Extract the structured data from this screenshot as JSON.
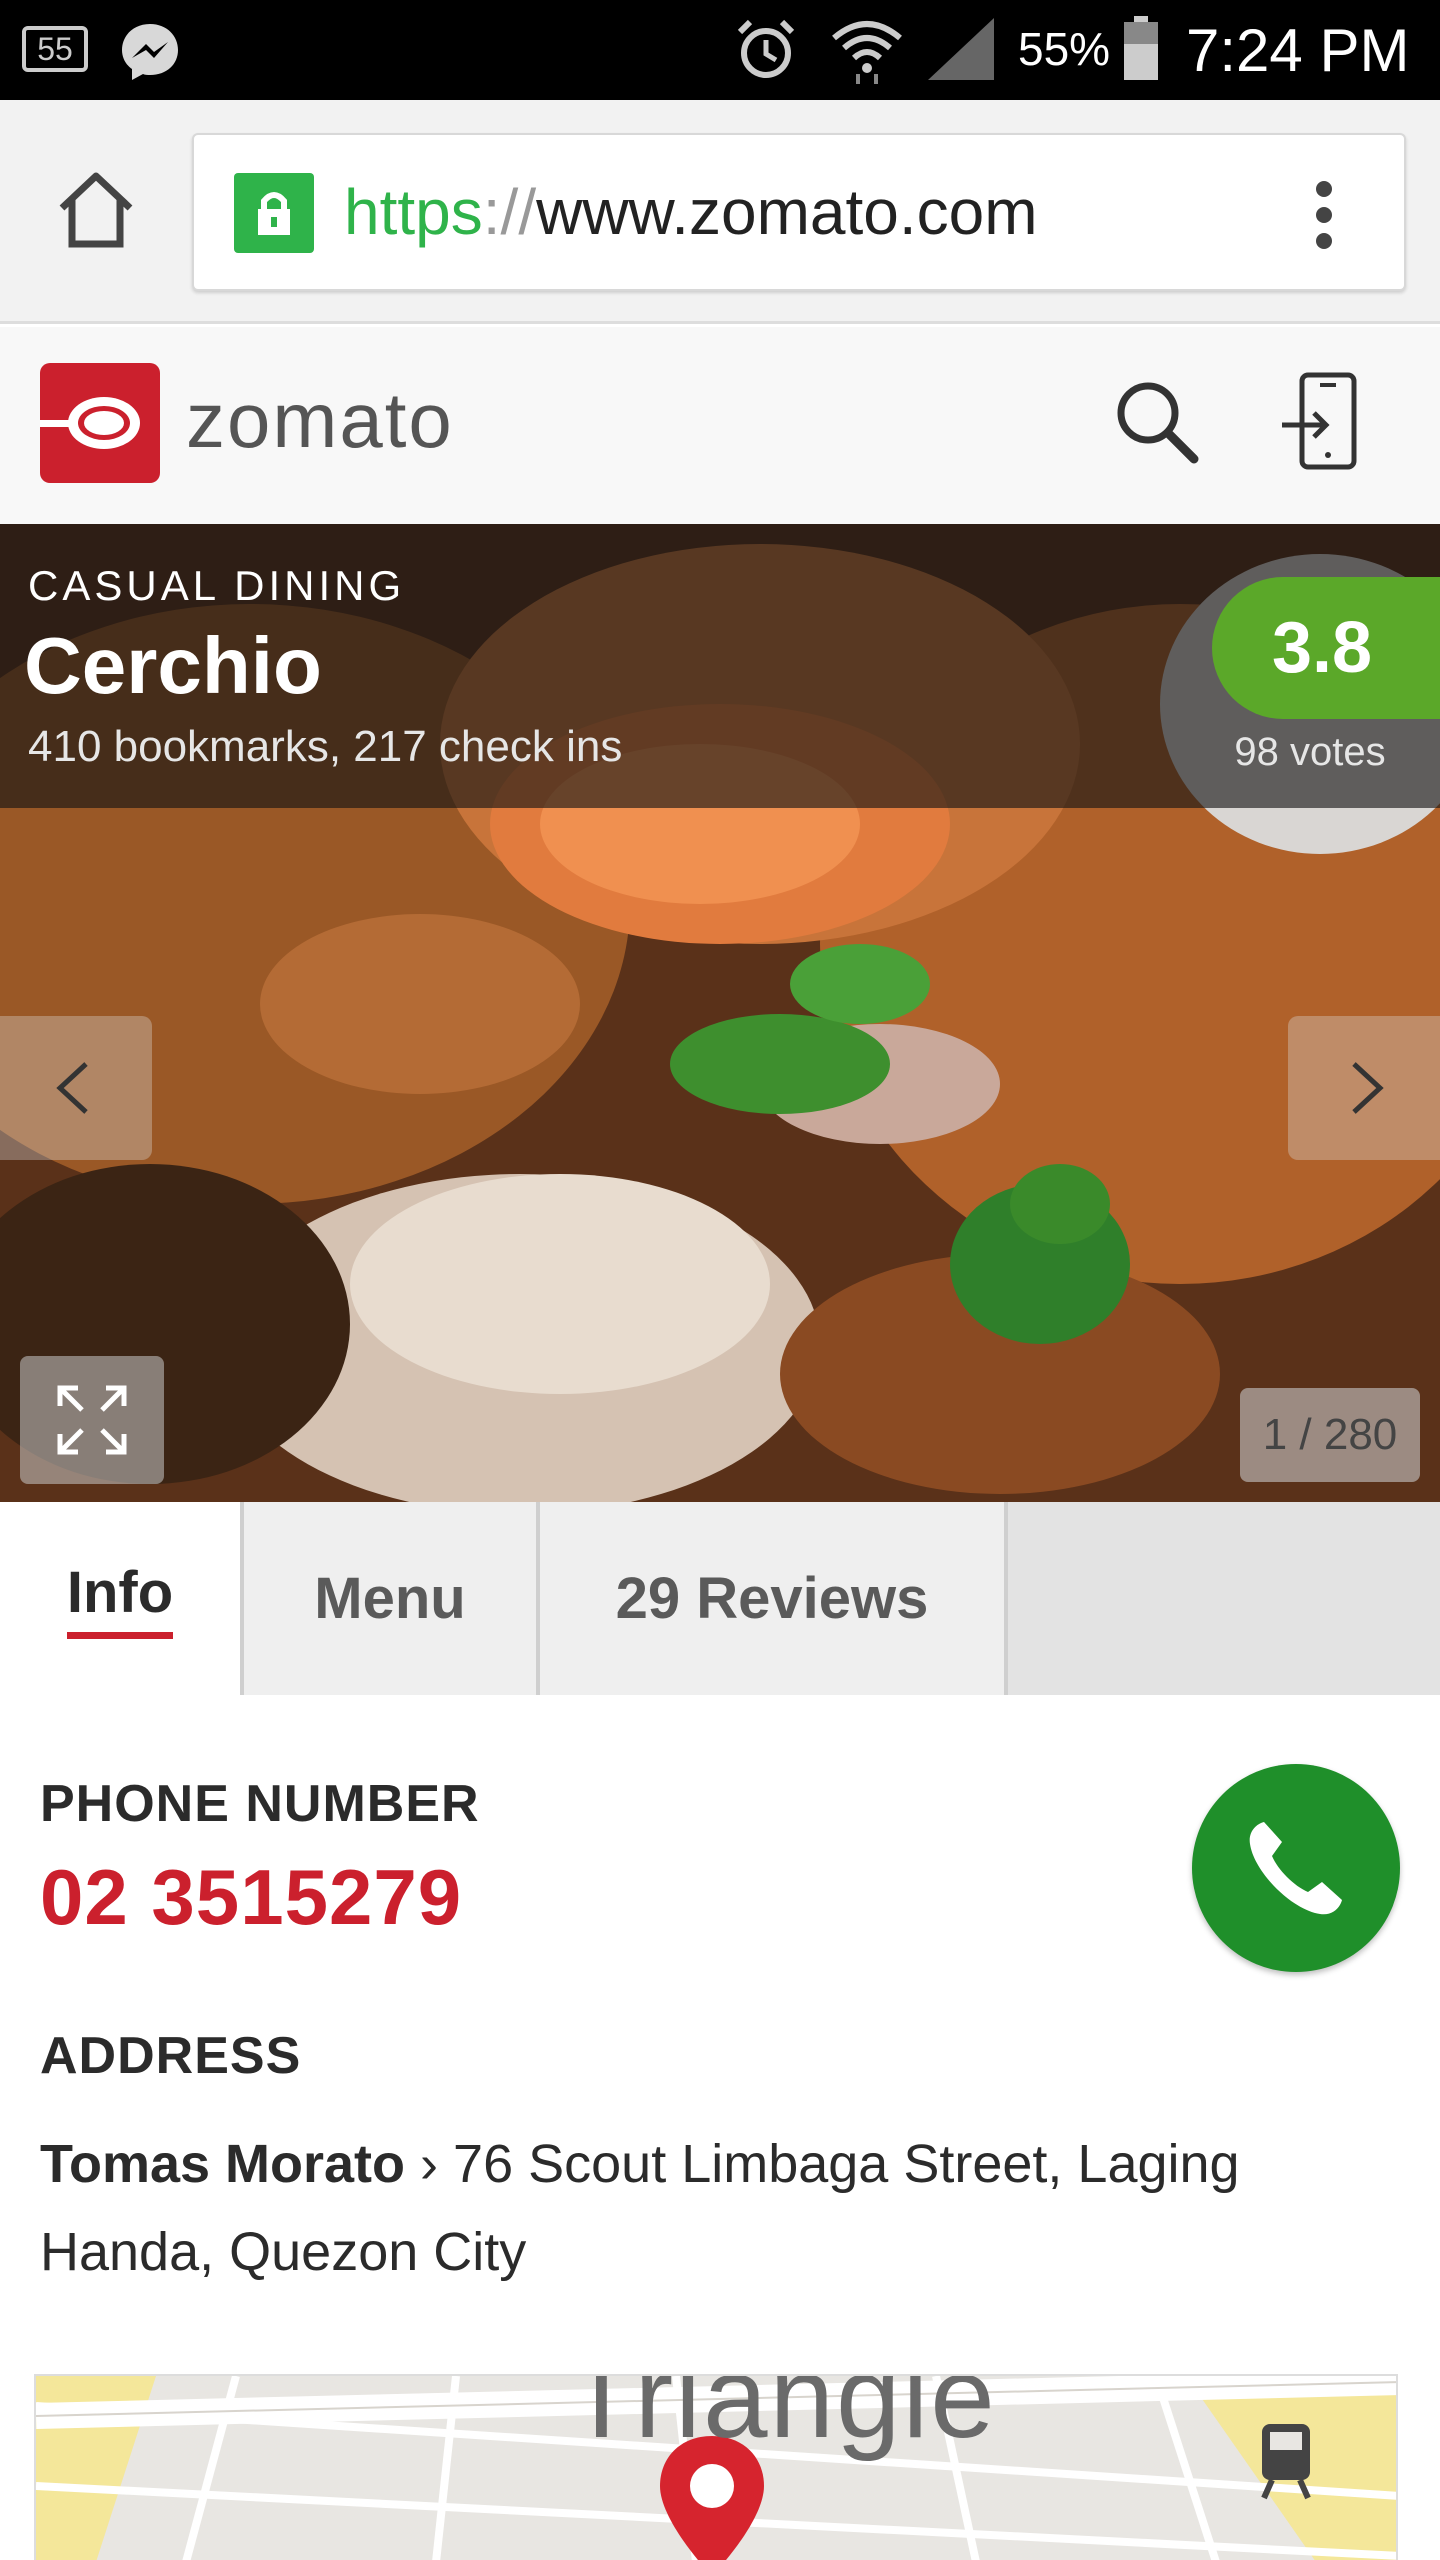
{
  "status_bar": {
    "notification_count": "55",
    "battery_percent": "55%",
    "time": "7:24 PM",
    "icons": [
      "notification-count-icon",
      "messenger-icon",
      "alarm-icon",
      "wifi-icon",
      "signal-icon",
      "battery-icon"
    ]
  },
  "browser": {
    "url_scheme": "https",
    "url_sep": "://",
    "url_host": "www.zomato.com",
    "icons": [
      "home-icon",
      "lock-icon",
      "overflow-menu-icon"
    ]
  },
  "site_header": {
    "brand": "zomato",
    "icons": [
      "zomato-logo-icon",
      "search-icon",
      "app-login-icon"
    ]
  },
  "restaurant": {
    "category": "CASUAL DINING",
    "name": "Cerchio",
    "stats": "410 bookmarks, 217 check ins",
    "rating": "3.8",
    "votes": "98 votes",
    "photo_counter": "1 / 280"
  },
  "tabs": [
    {
      "label": "Info",
      "active": true
    },
    {
      "label": "Menu",
      "active": false
    },
    {
      "label": "29 Reviews",
      "active": false
    }
  ],
  "info": {
    "phone_label": "PHONE NUMBER",
    "phone_number": "02 3515279",
    "address_label": "ADDRESS",
    "address_locality": "Tomas Morato",
    "address_separator": "›",
    "address_line1": "76 Scout Limbaga Street, Laging",
    "address_line2": "Handa, Quezon City",
    "map_label": "Triangle"
  },
  "colors": {
    "brand_red": "#cb202d",
    "rating_green": "#5ba829",
    "call_green": "#1f8f2a",
    "lock_green": "#2fb34a"
  }
}
